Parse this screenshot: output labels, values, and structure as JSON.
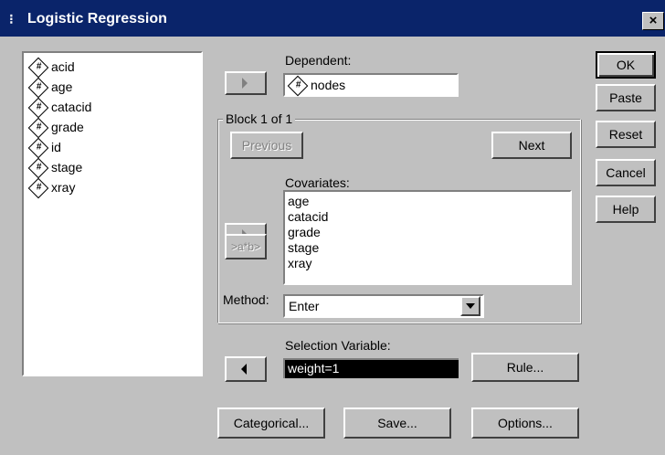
{
  "window": {
    "title": "Logistic Regression",
    "title_icon": "⁝",
    "close_label": "×"
  },
  "variables": [
    {
      "icon": "numeric-variable-icon",
      "name": "acid"
    },
    {
      "icon": "numeric-variable-icon",
      "name": "age"
    },
    {
      "icon": "numeric-variable-icon",
      "name": "catacid"
    },
    {
      "icon": "numeric-variable-icon",
      "name": "grade"
    },
    {
      "icon": "numeric-variable-icon",
      "name": "id"
    },
    {
      "icon": "numeric-variable-icon",
      "name": "stage"
    },
    {
      "icon": "numeric-variable-icon",
      "name": "xray"
    }
  ],
  "dependent": {
    "label": "Dependent:",
    "value": "nodes"
  },
  "block": {
    "label": "Block 1 of 1",
    "previous_label": "Previous",
    "next_label": "Next"
  },
  "covariates": {
    "label": "Covariates:",
    "items": [
      "age",
      "catacid",
      "grade",
      "stage",
      "xray"
    ],
    "interaction_label": ">a*b>"
  },
  "method": {
    "label": "Method:",
    "value": "Enter"
  },
  "selection": {
    "label": "Selection Variable:",
    "value": "weight=1",
    "rule_label": "Rule..."
  },
  "side_buttons": {
    "ok": "OK",
    "paste": "Paste",
    "reset": "Reset",
    "cancel": "Cancel",
    "help": "Help"
  },
  "bottom_buttons": {
    "categorical": "Categorical...",
    "save": "Save...",
    "options": "Options..."
  },
  "colors": {
    "titlebar": "#0a246a",
    "dialog": "#c0c0c0",
    "selection_highlight": "#000000"
  }
}
